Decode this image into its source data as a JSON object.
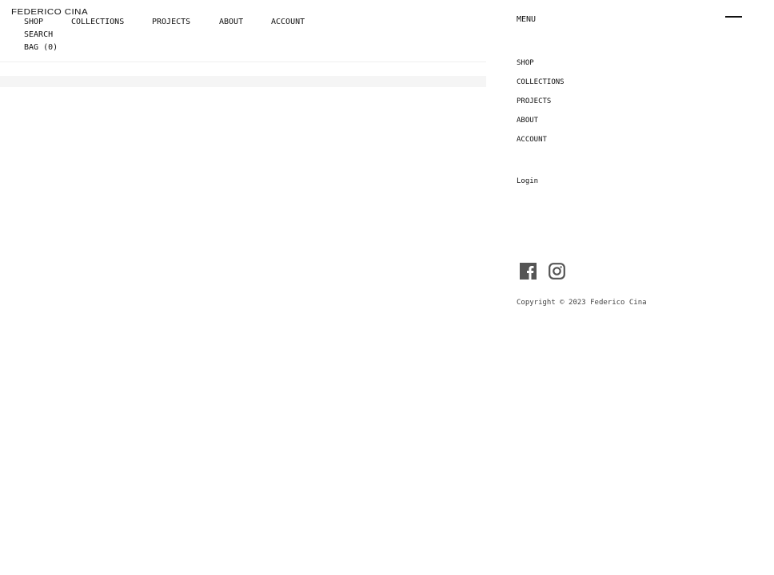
{
  "brand": "FEDERICO CINA",
  "header_nav": {
    "row1": [
      "SHOP",
      "COLLECTIONS",
      "PROJECTS",
      "ABOUT",
      "ACCOUNT"
    ],
    "search": "SEARCH",
    "bag": "BAG (0)"
  },
  "menu": {
    "title": "MENU",
    "items": [
      "SHOP",
      "COLLECTIONS",
      "PROJECTS",
      "ABOUT",
      "ACCOUNT"
    ],
    "login": "Login",
    "social": [
      {
        "name": "facebook-icon"
      },
      {
        "name": "instagram-icon"
      }
    ],
    "copyright": "Copyright © 2023 Federico Cina",
    "close_icon": "close-line-icon"
  },
  "colors": {
    "text": "#111111",
    "icon": "#555555",
    "band": "#f5f5f5",
    "divider": "#efefef"
  }
}
